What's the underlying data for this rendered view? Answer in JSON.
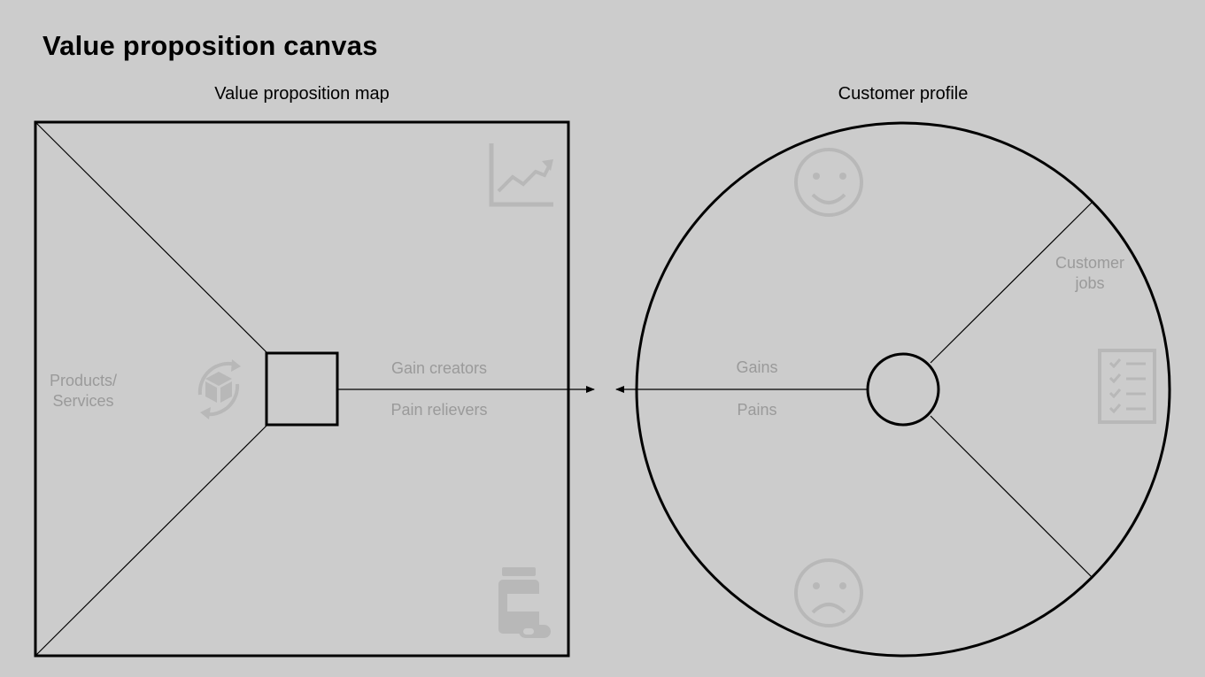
{
  "page": {
    "title": "Value proposition canvas"
  },
  "value_map": {
    "heading": "Value proposition map",
    "products_services": "Products/\nServices",
    "gain_creators": "Gain creators",
    "pain_relievers": "Pain relievers",
    "icons": [
      "trend-chart-icon",
      "product-cycle-icon",
      "medicine-icon"
    ]
  },
  "customer_profile": {
    "heading": "Customer profile",
    "customer_jobs": "Customer\njobs",
    "gains": "Gains",
    "pains": "Pains",
    "icons": [
      "smile-icon",
      "checklist-icon",
      "frown-icon"
    ]
  },
  "colors": {
    "background": "#cccccc",
    "stroke": "#000000",
    "muted_text": "#9a9a9a",
    "icon": "#b8b8b8"
  }
}
